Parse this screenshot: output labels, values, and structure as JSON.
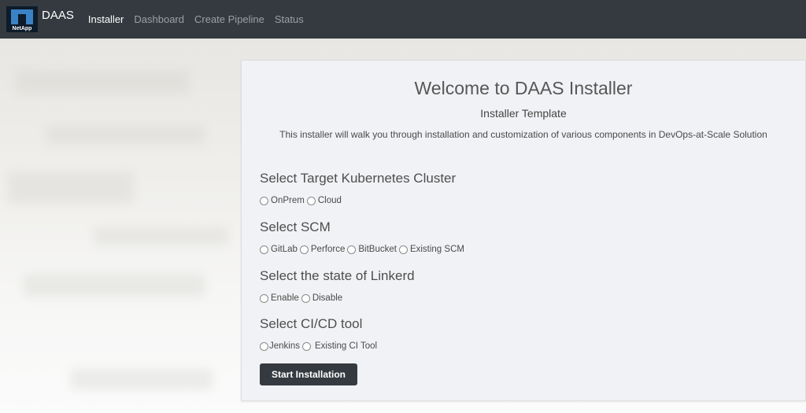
{
  "navbar": {
    "brand": "DAAS",
    "logo_text": "NetApp",
    "links": [
      {
        "label": "Installer",
        "active": true
      },
      {
        "label": "Dashboard",
        "active": false
      },
      {
        "label": "Create Pipeline",
        "active": false
      },
      {
        "label": "Status",
        "active": false
      }
    ]
  },
  "card": {
    "title": "Welcome to DAAS Installer",
    "subtitle": "Installer Template",
    "description": "This installer will walk you through installation and customization of various components in DevOps-at-Scale Solution",
    "sections": [
      {
        "title": "Select Target Kubernetes Cluster",
        "options": [
          "OnPrem",
          "Cloud"
        ]
      },
      {
        "title": "Select SCM",
        "options": [
          "GitLab",
          "Perforce",
          "BitBucket",
          "Existing SCM"
        ]
      },
      {
        "title": "Select the state of Linkerd",
        "options": [
          "Enable",
          "Disable"
        ]
      },
      {
        "title": "Select CI/CD tool",
        "options": [
          "Jenkins",
          "Existing CI Tool"
        ]
      }
    ],
    "start_button": "Start Installation"
  },
  "colors": {
    "navbar_bg": "#343a40",
    "card_bg": "#f1f2f5",
    "button_bg": "#343a40"
  }
}
